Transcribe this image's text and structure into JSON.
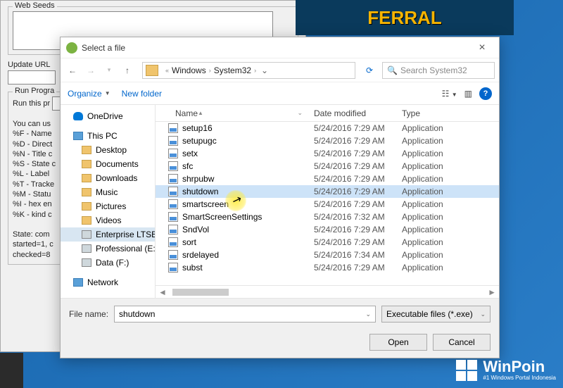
{
  "parent": {
    "group_webseeds": "Web Seeds",
    "update_url_label": "Update URL",
    "run_group": "Run Progra",
    "run_label": "Run this pr",
    "tokens_intro": "You can us",
    "tokens": [
      "%F - Name",
      "%D - Direct",
      "%N - Title c",
      "%S - State c",
      "%L - Label",
      "%T - Tracke",
      "%M - Statu",
      "%I - hex en",
      "%K - kind c"
    ],
    "state": [
      "State: com",
      "started=1, c",
      "checked=8"
    ]
  },
  "ad_text": "FERRAL",
  "dialog": {
    "title": "Select a file",
    "breadcrumb": {
      "seg1": "Windows",
      "seg2": "System32"
    },
    "search_placeholder": "Search System32",
    "toolbar": {
      "organize": "Organize",
      "newfolder": "New folder"
    },
    "columns": {
      "name": "Name",
      "date": "Date modified",
      "type": "Type"
    },
    "files": [
      {
        "name": "setup16",
        "date": "5/24/2016 7:29 AM",
        "type": "Application",
        "sel": false
      },
      {
        "name": "setupugc",
        "date": "5/24/2016 7:29 AM",
        "type": "Application",
        "sel": false
      },
      {
        "name": "setx",
        "date": "5/24/2016 7:29 AM",
        "type": "Application",
        "sel": false
      },
      {
        "name": "sfc",
        "date": "5/24/2016 7:29 AM",
        "type": "Application",
        "sel": false
      },
      {
        "name": "shrpubw",
        "date": "5/24/2016 7:29 AM",
        "type": "Application",
        "sel": false
      },
      {
        "name": "shutdown",
        "date": "5/24/2016 7:29 AM",
        "type": "Application",
        "sel": true
      },
      {
        "name": "smartscreen",
        "date": "5/24/2016 7:29 AM",
        "type": "Application",
        "sel": false
      },
      {
        "name": "SmartScreenSettings",
        "date": "5/24/2016 7:32 AM",
        "type": "Application",
        "sel": false
      },
      {
        "name": "SndVol",
        "date": "5/24/2016 7:29 AM",
        "type": "Application",
        "sel": false
      },
      {
        "name": "sort",
        "date": "5/24/2016 7:29 AM",
        "type": "Application",
        "sel": false
      },
      {
        "name": "srdelayed",
        "date": "5/24/2016 7:34 AM",
        "type": "Application",
        "sel": false
      },
      {
        "name": "subst",
        "date": "5/24/2016 7:29 AM",
        "type": "Application",
        "sel": false
      }
    ],
    "sidebar": {
      "onedrive": "OneDrive",
      "thispc": "This PC",
      "items": [
        "Desktop",
        "Documents",
        "Downloads",
        "Music",
        "Pictures",
        "Videos",
        "Enterprise LTSB (",
        "Professional (E:)",
        "Data (F:)"
      ],
      "network": "Network"
    },
    "footer": {
      "filename_label": "File name:",
      "filename_value": "shutdown",
      "filter": "Executable files (*.exe)",
      "open": "Open",
      "cancel": "Cancel"
    }
  },
  "winpoint": {
    "name": "WinPoin",
    "tag": "#1 Windows Portal Indonesia"
  }
}
